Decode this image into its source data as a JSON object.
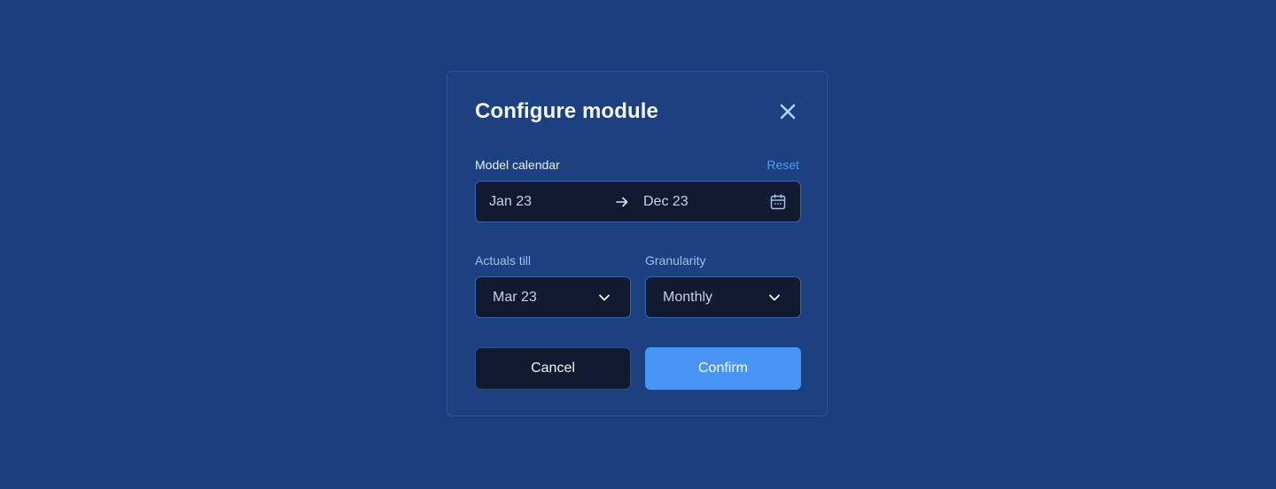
{
  "modal": {
    "title": "Configure module",
    "close_icon": "close-icon"
  },
  "model_calendar": {
    "label": "Model calendar",
    "reset_label": "Reset",
    "start": "Jan 23",
    "arrow_icon": "arrow-right-icon",
    "end": "Dec 23",
    "calendar_icon": "calendar-icon"
  },
  "actuals_till": {
    "label": "Actuals till",
    "value": "Mar 23",
    "icon": "chevron-down-icon"
  },
  "granularity": {
    "label": "Granularity",
    "value": "Monthly",
    "icon": "chevron-down-icon"
  },
  "actions": {
    "cancel_label": "Cancel",
    "confirm_label": "Confirm"
  },
  "colors": {
    "background": "#1b3f7e",
    "modal": "#1c4080",
    "field": "#111a2e",
    "accent": "#4895f6",
    "link": "#4d9cf6"
  }
}
